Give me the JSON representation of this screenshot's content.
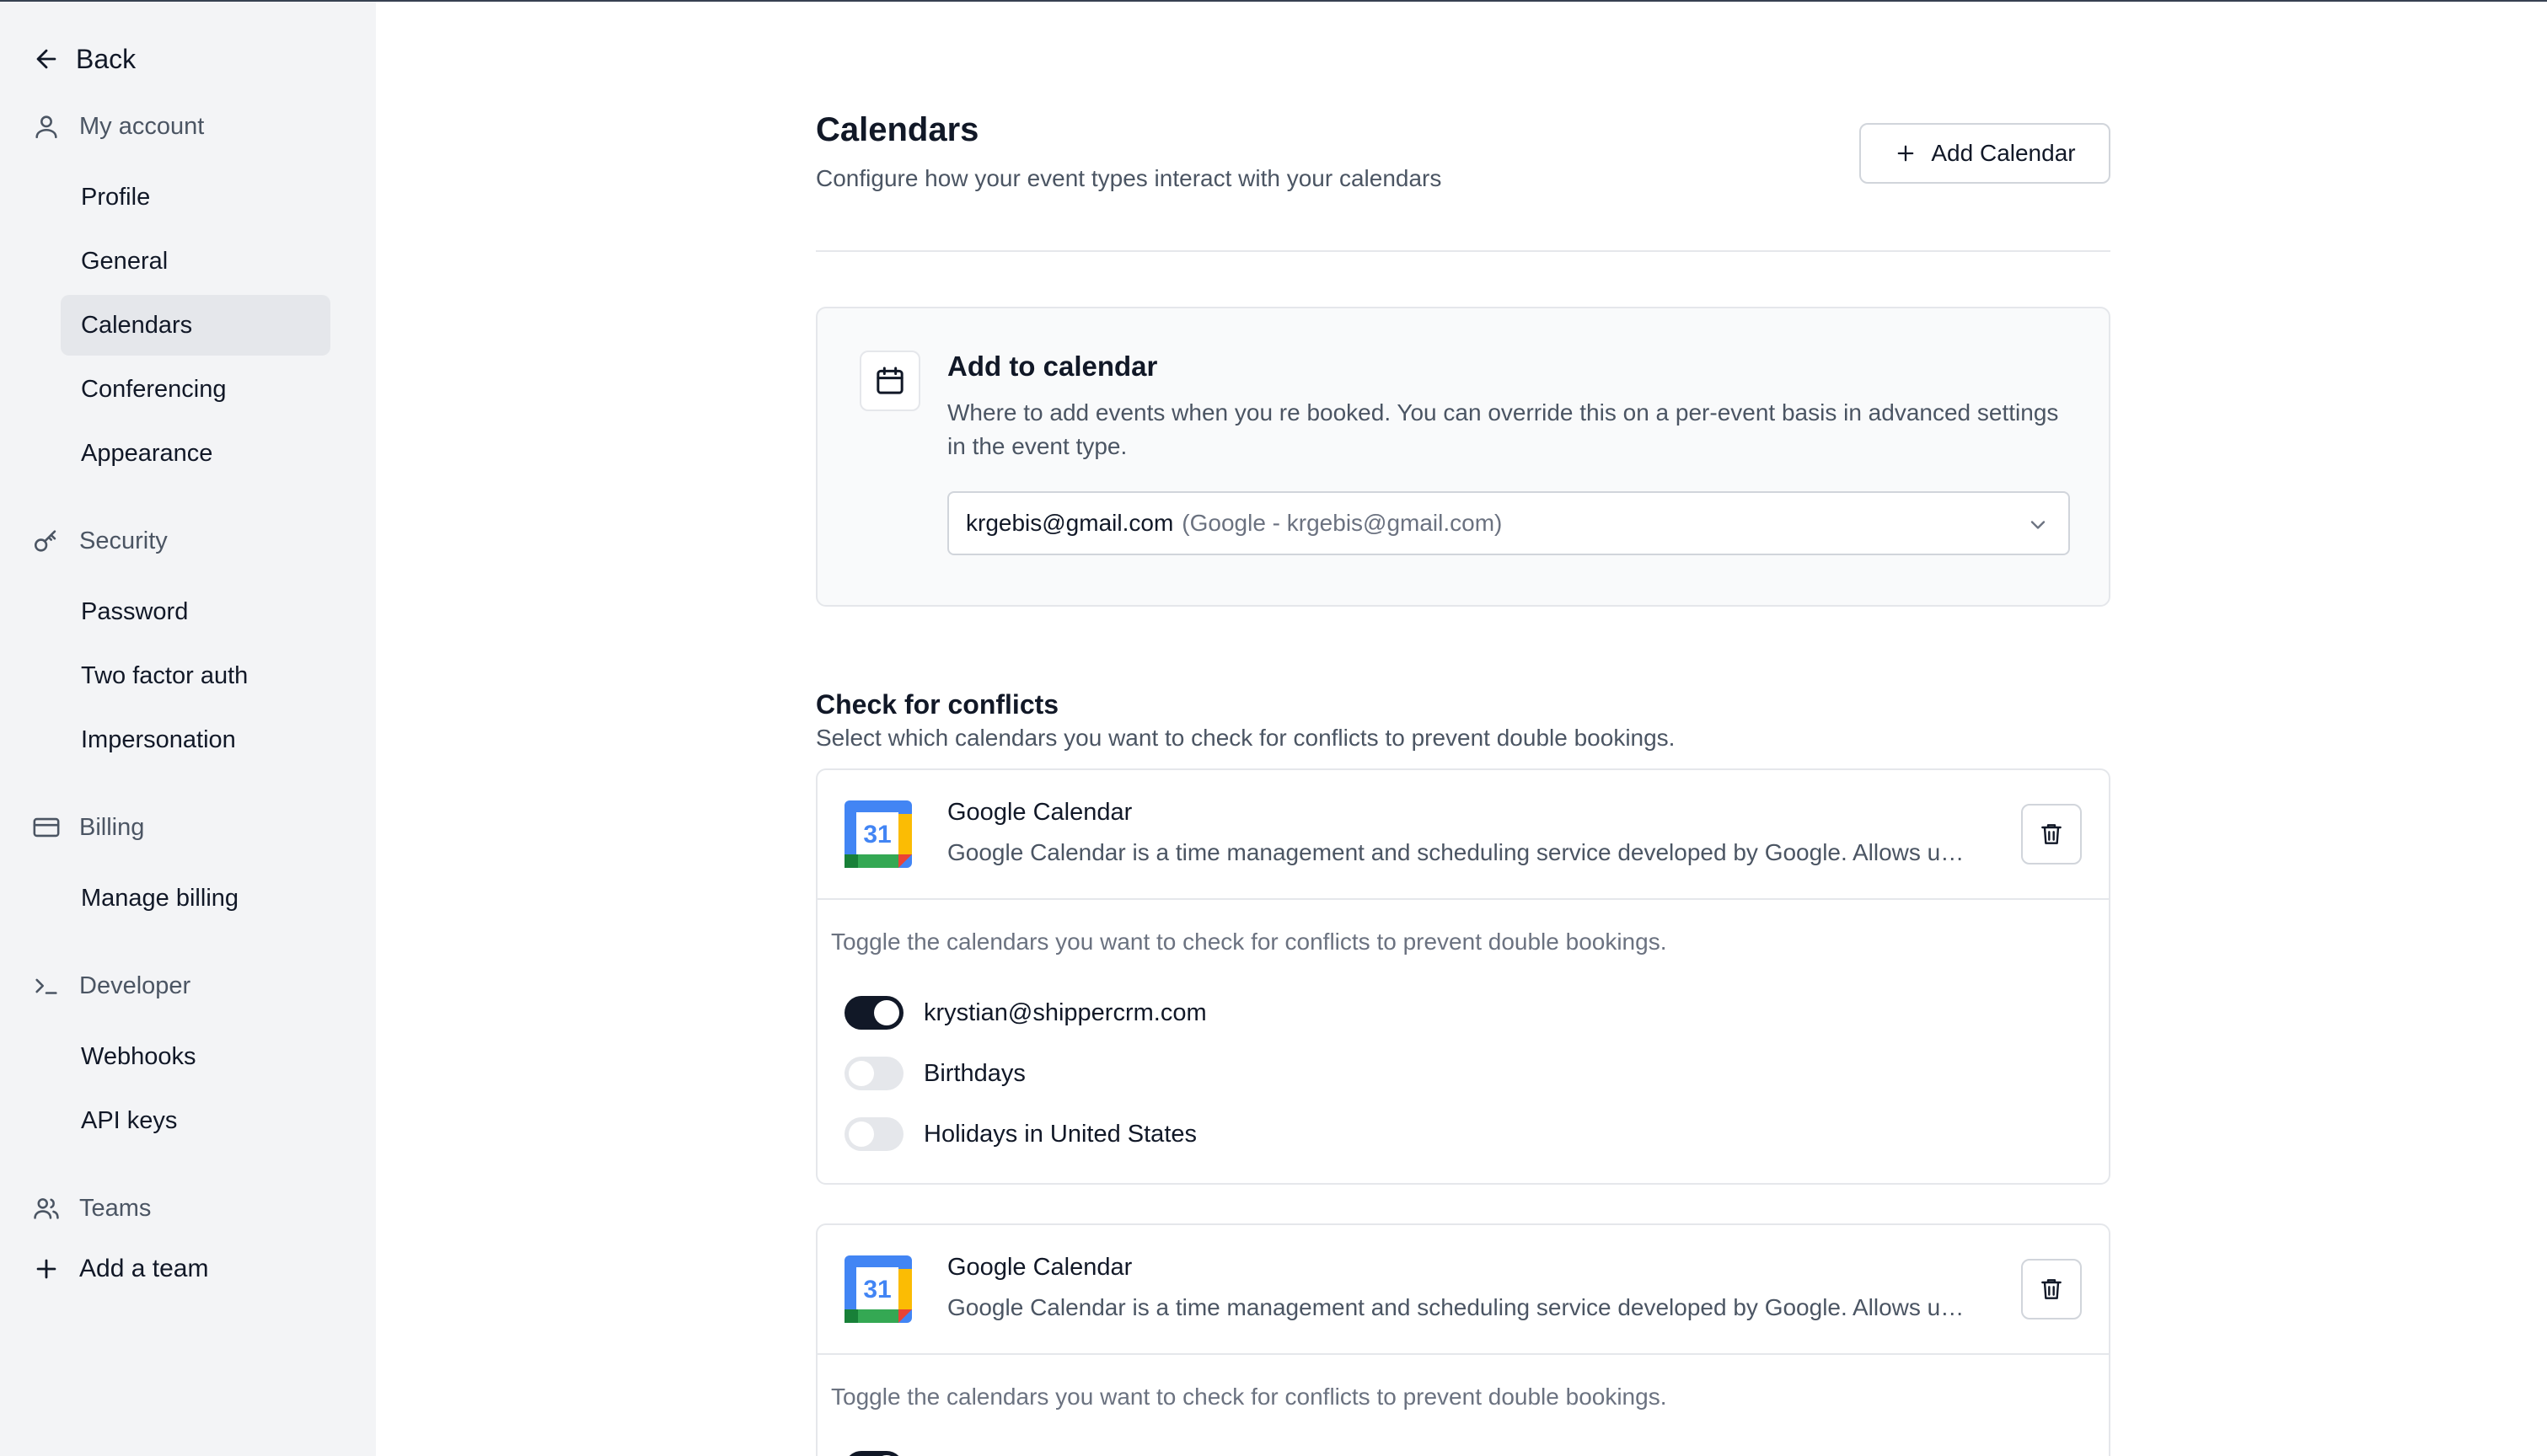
{
  "sidebar": {
    "back_label": "Back",
    "sections": {
      "my_account": "My account",
      "security": "Security",
      "billing": "Billing",
      "developer": "Developer",
      "teams": "Teams"
    },
    "items": {
      "profile": "Profile",
      "general": "General",
      "calendars": "Calendars",
      "conferencing": "Conferencing",
      "appearance": "Appearance",
      "password": "Password",
      "two_factor": "Two factor auth",
      "impersonation": "Impersonation",
      "manage_billing": "Manage billing",
      "webhooks": "Webhooks",
      "api_keys": "API keys"
    },
    "add_team": "Add a team",
    "active_item": "calendars"
  },
  "header": {
    "title": "Calendars",
    "subtitle": "Configure how your event types interact with your calendars",
    "add_calendar_label": "Add Calendar"
  },
  "add_to_calendar": {
    "title": "Add to calendar",
    "description": "Where to add events when you re booked. You can override this on a per-event basis in advanced settings in the event type.",
    "selected_value": "krgebis@gmail.com",
    "selected_sub": "(Google - krgebis@gmail.com)"
  },
  "conflicts": {
    "title": "Check for conflicts",
    "description": "Select which calendars you want to check for conflicts to prevent double bookings.",
    "cards": [
      {
        "name": "Google Calendar",
        "description": "Google Calendar is a time management and scheduling service developed by Google. Allows users to create and edit events, with options available for type and time.",
        "toggle_hint": "Toggle the calendars you want to check for conflicts to prevent double bookings.",
        "calendars": [
          {
            "label": "krystian@shippercrm.com",
            "enabled": true
          },
          {
            "label": "Birthdays",
            "enabled": false
          },
          {
            "label": "Holidays in United States",
            "enabled": false
          }
        ]
      },
      {
        "name": "Google Calendar",
        "description": "Google Calendar is a time management and scheduling service developed by Google. Allows users to create and edit events, with options available for type and time.",
        "toggle_hint": "Toggle the calendars you want to check for conflicts to prevent double bookings."
      }
    ]
  },
  "icons": {
    "back": "arrow-left-icon",
    "my_account": "user-icon",
    "security": "key-icon",
    "billing": "credit-card-icon",
    "developer": "terminal-icon",
    "teams": "users-icon",
    "add_team": "plus-icon",
    "add_calendar": "plus-icon",
    "add_to_calendar": "calendar-icon",
    "select": "chevron-down-icon",
    "delete": "trash-icon",
    "calendar_logo": "google-calendar-icon"
  },
  "colors": {
    "sidebar_bg": "#f3f4f6",
    "active_bg": "#e5e7eb",
    "switch_on": "#111827",
    "switch_off": "#e5e7eb",
    "gcal_blue": "#4285f4",
    "gcal_green": "#34a853",
    "gcal_yellow": "#fbbc04",
    "gcal_red": "#ea4335"
  }
}
